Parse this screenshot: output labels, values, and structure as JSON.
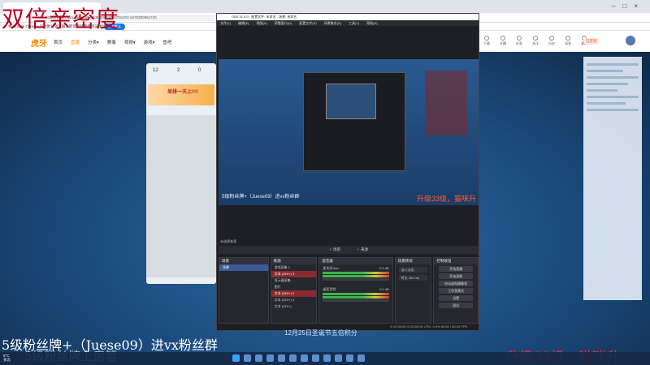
{
  "browser": {
    "tab_title": "",
    "address": "https://www.huya.com/...a0-ddd8b53d5d08370c074-2e7b300051720",
    "infobar_text": "将 Google Chrome 设为默认浏览器，即可保持最佳浏览体验",
    "infobar_button": "设为默认"
  },
  "site": {
    "logo": "虎牙",
    "nav": [
      "首页",
      "直播",
      "分类▾",
      "赛事",
      "视频▾",
      "游戏▾",
      "鱼吧"
    ],
    "right_icons": [
      "下载",
      "开播",
      "任务",
      "关注",
      "历史",
      "消息",
      "我的"
    ],
    "badge": "已签到",
    "card_stats": [
      "12",
      "2",
      "0"
    ],
    "promo_label": "单排一天上!!!!"
  },
  "obs": {
    "title": "OBS 31.0.0 - 配置文件: 未命名 - 场景: 未命名",
    "menu": [
      "文件(F)",
      "编辑(E)",
      "视图(V)",
      "停靠窗口(D)",
      "配置文件(P)",
      "场景集合(S)",
      "工具(T)",
      "帮助(H)"
    ],
    "tabs": [
      "✓ 场景",
      "✓ 来源"
    ],
    "docks": {
      "scenes_title": "场景",
      "scenes": [
        "场景"
      ],
      "sources_title": "来源",
      "sources": [
        "游戏采集 2",
        "文本 (GDI+) 3",
        "显示器采集",
        "图片",
        "文本 (GDI+) 2",
        "文本 (GDI+) 4",
        "文本 (GDI+)"
      ],
      "mixer_title": "混音器",
      "mixer": [
        {
          "name": "桌面音频",
          "level": "0.0 dB"
        },
        {
          "name": "麦克风/Aux",
          "level": "0.0 dB"
        }
      ],
      "transitions_title": "场景转场",
      "transition_type": "淡入淡出",
      "transition_duration_label": "时长",
      "transition_duration": "300 ms",
      "controls_title": "控制按钮",
      "controls": [
        "开始直播",
        "开始录制",
        "启动虚拟摄像机",
        "工作室模式",
        "设置",
        "退出"
      ]
    },
    "status": "⊙ 00:00:00   ⊙ 00:00:00   CPU: 0.4%   60.00 / 60.00 FPS",
    "scene_label": "未选择来源"
  },
  "overlays": {
    "title": "双倍亲密度",
    "bottom_left": "5级粉丝牌+（Juese09）进vx粉丝群",
    "bottom_left2": "5级粉丝牌上房管",
    "bottom_right": "升级33级，猫咪升",
    "center_note": "12月25日圣诞节五倍积分",
    "mid_right": "升级33级，猫咪升"
  },
  "taskbar": {
    "weather_temp": "9°C",
    "weather_text": "多云",
    "time": "",
    "date": ""
  }
}
